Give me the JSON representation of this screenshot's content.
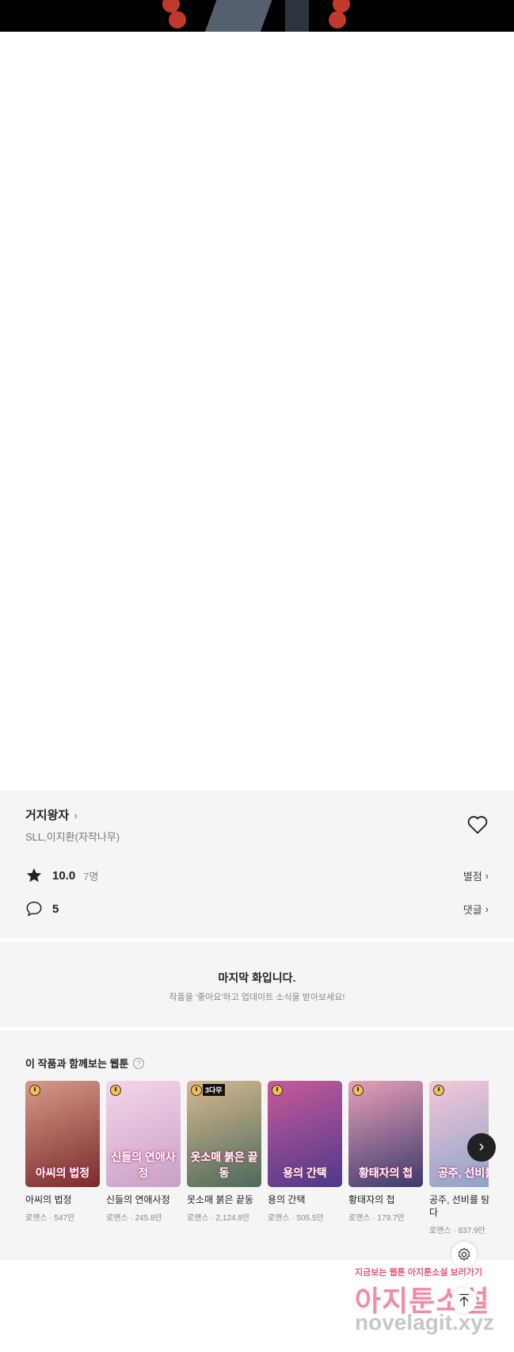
{
  "work": {
    "title": "거지왕자",
    "author": "SLL,이지환(자작나무)",
    "rating": "10.0",
    "rating_count": "7명",
    "rating_link": "별점",
    "comment_count": "5",
    "comment_link": "댓글"
  },
  "last_episode": {
    "heading": "마지막 화입니다.",
    "sub": "작품을 '좋아요'하고 업데이트 소식을 받아보세요!"
  },
  "recommend": {
    "heading": "이 작품과 함께보는 웹툰",
    "items": [
      {
        "name": "아씨의 법정",
        "meta": "로맨스 · 547만",
        "poster": "아씨의 법정",
        "color1": "#7a2a2a",
        "color2": "#d89a8a"
      },
      {
        "name": "신들의 연애사정",
        "meta": "로맨스 · 245.8만",
        "poster": "신들의 연애사정",
        "color1": "#c8a0c8",
        "color2": "#f4d6e8"
      },
      {
        "name": "못소매 붉은 끝동",
        "meta": "로맨스 · 2,124.8만",
        "poster": "옷소매 붉은 끝동",
        "badge": "3다무",
        "color1": "#4a6a5a",
        "color2": "#d8b890"
      },
      {
        "name": "용의 간택",
        "meta": "로맨스 · 505.5만",
        "poster": "용의 간택",
        "color1": "#4a3a8a",
        "color2": "#c85a9a"
      },
      {
        "name": "황태자의 첩",
        "meta": "로맨스 · 179.7만",
        "poster": "황태자의 첩",
        "color1": "#3a3a6a",
        "color2": "#e8a0b8"
      },
      {
        "name": "공주, 선비를 탐하다",
        "meta": "로맨스 · 837.9만",
        "poster": "공주, 선비를",
        "color1": "#8aa0c8",
        "color2": "#f4c8d8"
      }
    ]
  },
  "watermark": {
    "line1": "지금보는 웹툰 아지툰소설 보러가기",
    "line2": "아지툰소설",
    "line3": "novelagit.xyz"
  }
}
